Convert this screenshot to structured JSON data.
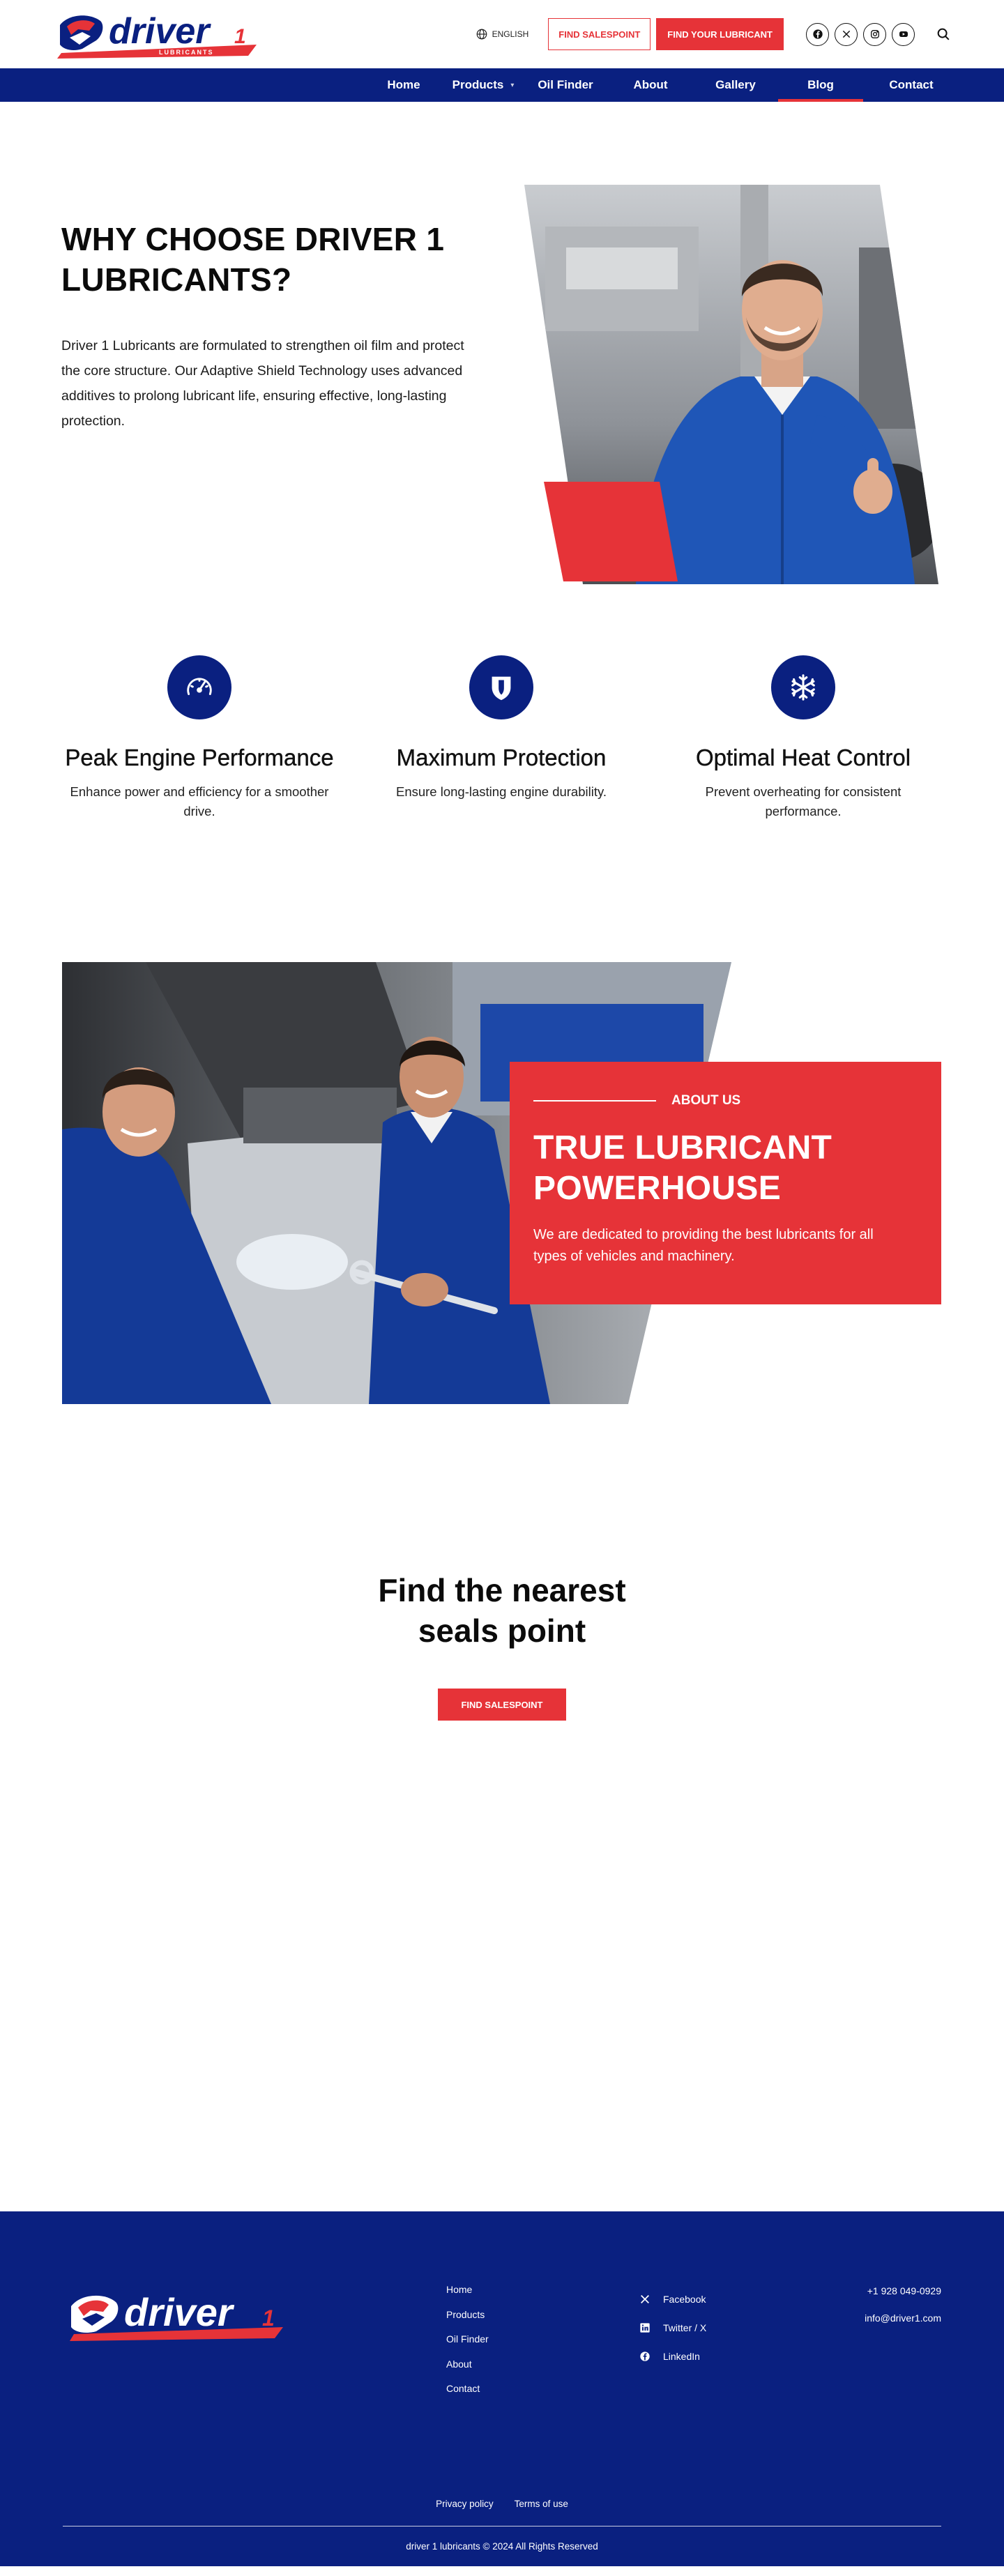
{
  "header": {
    "logo_text": "driver",
    "logo_subtext": "LUBRICANTS",
    "language": "ENGLISH",
    "find_salespoint": "FIND SALESPOINT",
    "find_lubricant": "FIND YOUR LUBRICANT",
    "socials": [
      "facebook-icon",
      "x-twitter-icon",
      "instagram-icon",
      "youtube-icon"
    ]
  },
  "nav": {
    "items": [
      {
        "label": "Home"
      },
      {
        "label": "Products"
      },
      {
        "label": "Oil Finder"
      },
      {
        "label": "About"
      },
      {
        "label": "Gallery"
      },
      {
        "label": "Blog"
      },
      {
        "label": "Contact"
      }
    ],
    "active": "Blog"
  },
  "why": {
    "title": "WHY CHOOSE DRIVER 1 LUBRICANTS?",
    "body": "Driver 1 Lubricants are formulated to strengthen oil film and protect the core structure. Our Adaptive Shield Technology uses advanced additives to prolong lubricant life, ensuring effective, long-lasting protection."
  },
  "features": [
    {
      "icon": "speedometer-icon",
      "title": "Peak Engine Performance",
      "text": "Enhance power and efficiency for a smoother drive."
    },
    {
      "icon": "shield-icon",
      "title": "Maximum Protection",
      "text": "Ensure long-lasting engine durability."
    },
    {
      "icon": "snowflake-icon",
      "title": "Optimal Heat Control",
      "text": "Prevent overheating for consistent performance."
    }
  ],
  "about": {
    "eyebrow": "ABOUT US",
    "title": "TRUE LUBRICANT POWERHOUSE",
    "body": "We are dedicated to providing the best lubricants for all types of vehicles and machinery."
  },
  "find": {
    "title_line1": "Find the nearest",
    "title_line2": "seals point",
    "button": "FIND SALESPOINT"
  },
  "footer": {
    "links": [
      "Home",
      "Products",
      "Oil Finder",
      "About",
      "Contact"
    ],
    "socials": [
      {
        "icon": "x-twitter-icon",
        "label": "Facebook"
      },
      {
        "icon": "linkedin-icon",
        "label": "Twitter / X"
      },
      {
        "icon": "facebook-icon",
        "label": "LinkedIn"
      }
    ],
    "phone": "+1 928 049-0929",
    "email": "info@driver1.com",
    "legal": [
      "Privacy policy",
      "Terms of use"
    ],
    "copyright": "driver 1 lubricants © 2024 All Rights Reserved"
  },
  "colors": {
    "brand_blue": "#0a2080",
    "brand_red": "#e63338"
  }
}
